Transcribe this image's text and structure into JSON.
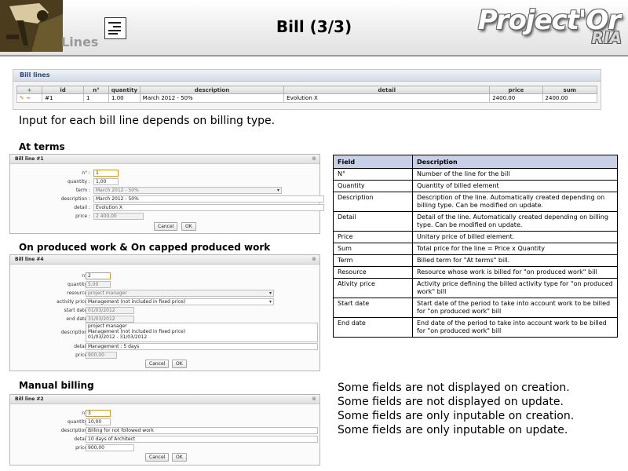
{
  "header": {
    "section": "Lines",
    "title": "Bill (3/3)",
    "brand": "Project'Or",
    "brand_suffix": "RIA"
  },
  "bill_lines": {
    "title": "Bill lines",
    "columns": [
      "",
      "id",
      "n°",
      "quantity",
      "description",
      "detail",
      "price",
      "sum"
    ],
    "rows": [
      {
        "id": "#1",
        "n": "1",
        "quantity": "1.00",
        "description": "March 2012 - 50%",
        "detail": "Evolution X",
        "price": "2400.00",
        "sum": "2400.00"
      }
    ]
  },
  "intro": "Input for each bill line depends on billing type.",
  "sections": {
    "terms": "At terms",
    "produced": "On produced work & On capped produced work",
    "manual": "Manual billing"
  },
  "dialog1": {
    "title": "Bill line #1",
    "labels": {
      "n": "n° :",
      "quantity": "quantity :",
      "term": "term :",
      "description": "description :",
      "detail": "detail :",
      "price": "price :"
    },
    "values": {
      "n": "1",
      "quantity": "1,00",
      "term": "March 2012 - 50%",
      "description": "March 2012 - 50%",
      "detail": "Evolution X",
      "price": "2 400,00"
    },
    "cancel": "Cancel",
    "ok": "OK"
  },
  "dialog2": {
    "title": "Bill line #4",
    "labels": {
      "n": "n° :",
      "quantity": "quantity :",
      "resource": "resource :",
      "activity_price": "activity price :",
      "start_date": "start date :",
      "end_date": "end date :",
      "description": "description :",
      "detail": "detail :",
      "price": "price :"
    },
    "values": {
      "n": "2",
      "quantity": "5,00",
      "resource": "project manager",
      "activity_price": "Management (not included in fixed price)",
      "start_date": "01/03/2012",
      "end_date": "31/03/2012",
      "description_1": "project manager",
      "description_2": "Management (not included in fixed price)",
      "description_3": "01/03/2012 - 31/03/2012",
      "detail": "Management : 5 days",
      "price": "900,00"
    },
    "cancel": "Cancel",
    "ok": "OK"
  },
  "dialog3": {
    "title": "Bill line #2",
    "labels": {
      "n": "n° :",
      "quantity": "quantity :",
      "description": "description :",
      "detail": "detail :",
      "price": "price :"
    },
    "values": {
      "n": "3",
      "quantity": "10,00",
      "description": "Billing for not followed work",
      "detail": "10 days of Architect",
      "price": "900,00"
    },
    "cancel": "Cancel",
    "ok": "OK"
  },
  "field_table": {
    "headers": [
      "Field",
      "Description"
    ],
    "rows": [
      {
        "field": "N°",
        "desc": "Number of the line for the bill"
      },
      {
        "field": "Quantity",
        "desc": "Quantity of billed element"
      },
      {
        "field": "Description",
        "desc": "Description of the line. Automatically created depending on billing type.  Can be modified on update."
      },
      {
        "field": "Detail",
        "desc": "Detail of the line. Automatically created depending on billing type.  Can be modified on update."
      },
      {
        "field": "Price",
        "desc": "Unitary price of billed element."
      },
      {
        "field": "Sum",
        "desc": "Total price for the line = Price x Quantity"
      },
      {
        "field": "Term",
        "desc": "Billed term for \"At terms\" bill."
      },
      {
        "field": "Resource",
        "desc": "Resource whose work is billed for \"on produced work\" bill"
      },
      {
        "field": "Ativity price",
        "desc": "Activity price defining the billed activity type for \"on produced work\" bill"
      },
      {
        "field": "Start date",
        "desc": "Start date of the period  to take into account  work to be billed for \"on produced work\" bill"
      },
      {
        "field": "End date",
        "desc": "End date of the period  to take into account  work to be billed for \"on produced work\" bill"
      }
    ]
  },
  "notes": [
    "Some fields are not displayed on creation.",
    "Some fields are not displayed on update.",
    "Some fields are only inputable on creation.",
    "Some fields are only inputable on update."
  ]
}
